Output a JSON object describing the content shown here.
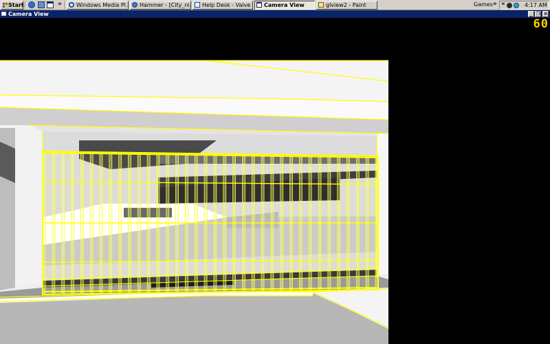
{
  "taskbar": {
    "start_label": "Start",
    "quick_launch_icons": [
      "internet-explorer-icon",
      "show-desktop-icon",
      "windows-explorer-icon"
    ],
    "overflow_chevron": "»",
    "tasks": [
      {
        "label": "Windows Media Pl...",
        "icon": "media-player-icon",
        "active": false
      },
      {
        "label": "Hammer - [City_ni...",
        "icon": "hammer-icon",
        "active": false
      },
      {
        "label": "Help Desk - Valve ...",
        "icon": "help-desk-icon",
        "active": false
      },
      {
        "label": "Camera View",
        "icon": "camera-view-icon",
        "active": true
      },
      {
        "label": "glview2 - Paint",
        "icon": "paint-icon",
        "active": false
      }
    ],
    "games_label": "Games",
    "tray_chevron": "»",
    "tray_expand": "«",
    "tray_icons": [
      "steam-icon",
      "network-icon"
    ],
    "clock": "4:17 AM"
  },
  "window": {
    "title": "Camera View",
    "minimize": "_",
    "restore": "❐",
    "close": "×"
  },
  "viewport": {
    "fps": "60",
    "colors": {
      "background": "#000000",
      "selection": "#ffff00",
      "surface_light": "#f0f0f0",
      "surface_gray": "#a0a0a0",
      "surface_dark": "#3a3a3a"
    }
  }
}
